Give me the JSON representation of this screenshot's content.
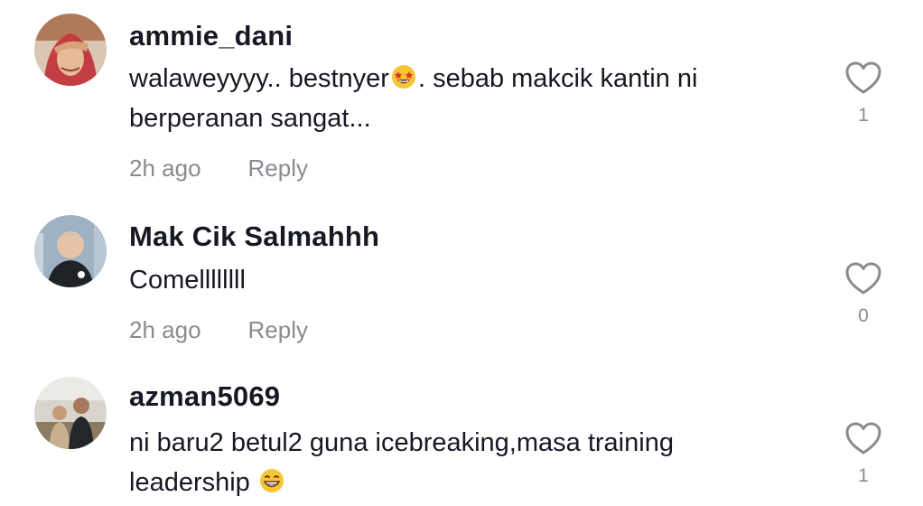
{
  "comments": [
    {
      "username": "ammie_dani",
      "text_part1": "walaweyyyy.. bestnyer",
      "emoji1": "star-struck-emoji",
      "text_part2": ". sebab makcik kantin ni",
      "text_line2": "berperanan sangat...",
      "time": "2h ago",
      "reply_label": "Reply",
      "like_count": "1"
    },
    {
      "username": "Mak Cik Salmahhh",
      "text": "Comellllllll",
      "time": "2h ago",
      "reply_label": "Reply",
      "like_count": "0"
    },
    {
      "username": "azman5069",
      "text_line1": "ni baru2 betul2 guna icebreaking,masa training",
      "text_part2": "leadership ",
      "emoji": "grinning-emoji",
      "like_count": "1"
    }
  ],
  "colors": {
    "primary_text": "#161823",
    "secondary_text": "#8a8b91",
    "heart_outline": "#8a8b91"
  },
  "icons": {
    "like": "heart-outline-icon"
  }
}
